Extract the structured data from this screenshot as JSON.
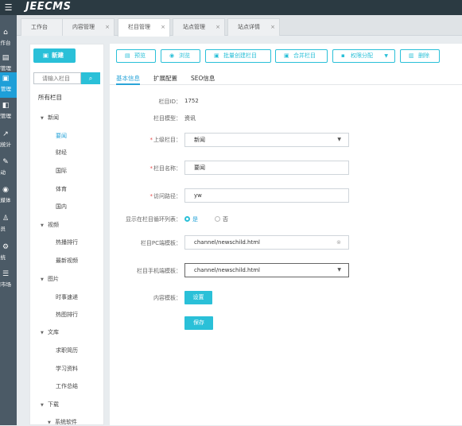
{
  "app": {
    "brand": "JEECMS"
  },
  "leftnav": {
    "items": [
      {
        "label": "工作台",
        "icon": "⌂"
      },
      {
        "label": "内容管理",
        "icon": "▤"
      },
      {
        "label": "栏目管理",
        "icon": "▣"
      },
      {
        "label": "模型管理",
        "icon": "◧"
      },
      {
        "label": "数据统计",
        "icon": "↗"
      },
      {
        "label": "互动",
        "icon": "✎"
      },
      {
        "label": "融媒体",
        "icon": "◉"
      },
      {
        "label": "会员",
        "icon": "♙"
      },
      {
        "label": "系统",
        "icon": "⚙"
      },
      {
        "label": "应用市场",
        "icon": "☰"
      }
    ]
  },
  "tabs": [
    {
      "label": "工作台",
      "closable": false
    },
    {
      "label": "内容管理",
      "closable": true
    },
    {
      "label": "栏目管理",
      "closable": true
    },
    {
      "label": "站点管理",
      "closable": true
    },
    {
      "label": "站点详情",
      "closable": true
    }
  ],
  "tree": {
    "new_label": "新建",
    "search_placeholder": "请输入栏目",
    "root": "所有栏目",
    "nodes": [
      {
        "label": "新闻",
        "group": true
      },
      {
        "label": "要闻",
        "selected": true
      },
      {
        "label": "财经"
      },
      {
        "label": "国际"
      },
      {
        "label": "体育"
      },
      {
        "label": "国内"
      },
      {
        "label": "视频",
        "group": true
      },
      {
        "label": "热播排行"
      },
      {
        "label": "最新视频"
      },
      {
        "label": "图片",
        "group": true
      },
      {
        "label": "时事速递"
      },
      {
        "label": "热图排行"
      },
      {
        "label": "文库",
        "group": true
      },
      {
        "label": "求职简历"
      },
      {
        "label": "学习资料"
      },
      {
        "label": "工作总结"
      },
      {
        "label": "下载",
        "group": true
      },
      {
        "label": "系统软件",
        "group": true
      }
    ]
  },
  "toolbar": {
    "preview": "预览",
    "browse": "浏览",
    "batch_create": "批量创建栏目",
    "merge": "合并栏目",
    "permission": "权限分配",
    "delete": "删除"
  },
  "subtabs": [
    "基本信息",
    "扩展配置",
    "SEO信息"
  ],
  "form": {
    "id_label": "栏目ID：",
    "id_value": "1752",
    "model_label": "栏目模型：",
    "model_value": "资讯",
    "parent_label": "上级栏目：",
    "parent_value": "新闻",
    "name_label": "栏目名称：",
    "name_value": "要闻",
    "path_label": "访问路径：",
    "path_value": "yw",
    "show_label": "显示在栏目循环列表：",
    "show_yes": "是",
    "show_no": "否",
    "pc_tpl_label": "栏目PC端模板：",
    "pc_tpl_value": "channel/newschild.html",
    "mobile_tpl_label": "栏目手机端模板：",
    "mobile_tpl_value": "channel/newschild.html",
    "content_tpl_label": "内容模板：",
    "settings_button": "设置",
    "save_button": "保存"
  }
}
